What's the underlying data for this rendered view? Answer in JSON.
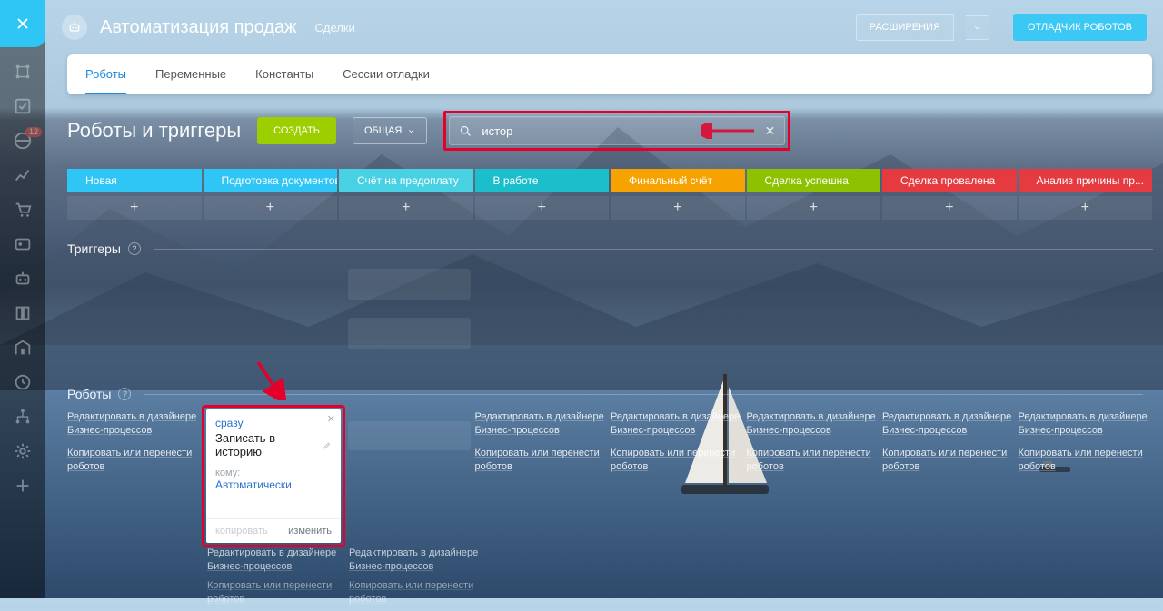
{
  "header": {
    "title": "Автоматизация продаж",
    "subtitle": "Сделки",
    "extensions": "РАСШИРЕНИЯ",
    "debugger": "ОТЛАДЧИК РОБОТОВ"
  },
  "tabs": {
    "robots": "Роботы",
    "variables": "Переменные",
    "constants": "Константы",
    "sessions": "Сессии отладки"
  },
  "page": {
    "title": "Роботы и триггеры",
    "create": "СОЗДАТЬ",
    "scope": "ОБЩАЯ",
    "search_value": "истор",
    "triggers_label": "Триггеры",
    "robots_label": "Роботы"
  },
  "stages": [
    {
      "name": "Новая",
      "color": "#2fc6f6"
    },
    {
      "name": "Подготовка документов",
      "color": "#2fc6f6"
    },
    {
      "name": "Счёт на предоплату",
      "color": "#47d1e2"
    },
    {
      "name": "В работе",
      "color": "#1bbecb"
    },
    {
      "name": "Финальный счёт",
      "color": "#f6a200"
    },
    {
      "name": "Сделка успешна",
      "color": "#8ec100"
    },
    {
      "name": "Сделка провалена",
      "color": "#e53a40"
    },
    {
      "name": "Анализ причины пр...",
      "color": "#e53a40"
    }
  ],
  "links": {
    "edit_bp": "Редактировать в дизайнере Бизнес-процессов",
    "copy_move": "Копировать или перенести роботов"
  },
  "robot_card": {
    "when": "сразу",
    "title": "Записать в историю",
    "to_label": "кому:",
    "to_value": "Автоматически",
    "copy": "копировать",
    "edit": "изменить"
  },
  "sidebar": {
    "badge": "12"
  }
}
